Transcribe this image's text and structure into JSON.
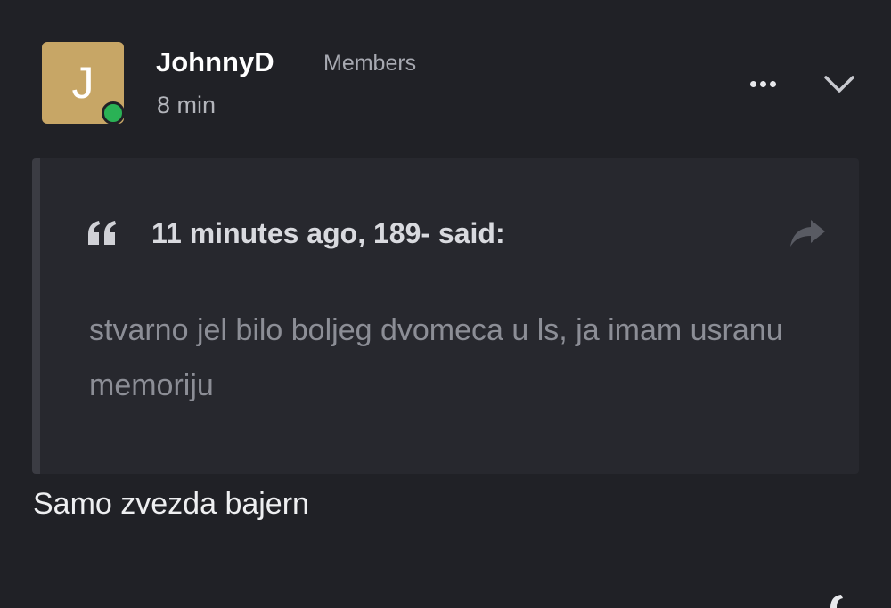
{
  "post": {
    "avatar_letter": "J",
    "author": "JohnnyD",
    "group": "Members",
    "time": "8 min",
    "online_color": "#2ab255",
    "avatar_color": "#c7a666"
  },
  "quote": {
    "citation": "11 minutes ago, 189- said:",
    "text": "stvarno jel bilo boljeg dvomeca u ls, ja imam usranu memoriju"
  },
  "reply": {
    "text": "Samo zvezda bajern"
  },
  "icons": {
    "more": "more-horizontal-icon",
    "expand": "chevron-down-icon",
    "quote": "quote-icon",
    "share": "share-icon"
  }
}
